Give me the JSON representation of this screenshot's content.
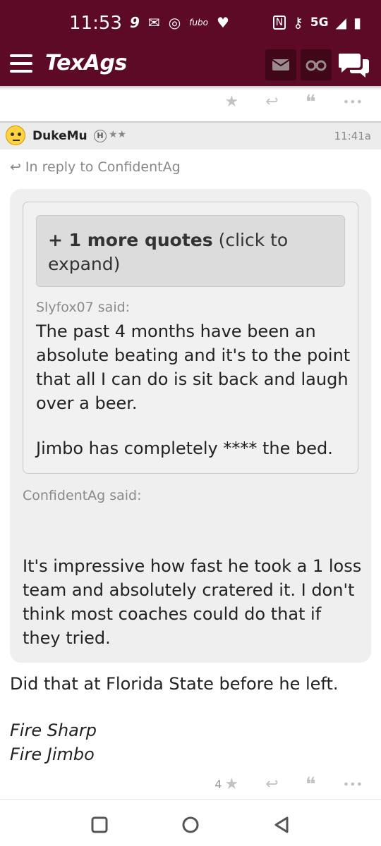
{
  "status_bar": {
    "time": "11:53",
    "left_icons": [
      "9",
      "✉",
      "◎",
      "fubo",
      "♥"
    ],
    "right_icons": [
      "N",
      "⚷",
      "5G",
      "◢",
      "▮"
    ]
  },
  "header": {
    "brand": "TexAgs"
  },
  "top_actions": {
    "star": "★",
    "reply": "↩",
    "quote": "❝",
    "more": "•••"
  },
  "post": {
    "username": "DukeMu",
    "badge": "H",
    "stars": "★★",
    "time": "11:41a",
    "reply_to": "In reply to ConfidentAg",
    "more_quotes_bold": "+ 1 more quotes",
    "more_quotes_rest": " (click to expand)",
    "quote1": {
      "author": "Slyfox07 said:",
      "para1": "The past 4 months have been an absolute beating and it's to the point that all I can do is sit back and laugh over a beer.",
      "para2": "Jimbo has completely **** the bed."
    },
    "quote2": {
      "author": "ConfidentAg said:",
      "text": "It's impressive how fast he took a 1 loss team and absolutely cratered it. I don't think most coaches could do that if they tried."
    },
    "body": "Did that at Florida State before he left.",
    "signature": [
      "Fire Sharp",
      "Fire Jimbo"
    ]
  },
  "bottom_actions": {
    "star_count": "4",
    "star": "★",
    "reply": "↩",
    "quote": "❝",
    "more": "•••"
  },
  "colors": {
    "brand": "#5c0a25",
    "muted": "#888888",
    "quote_bg": "#efefef"
  }
}
